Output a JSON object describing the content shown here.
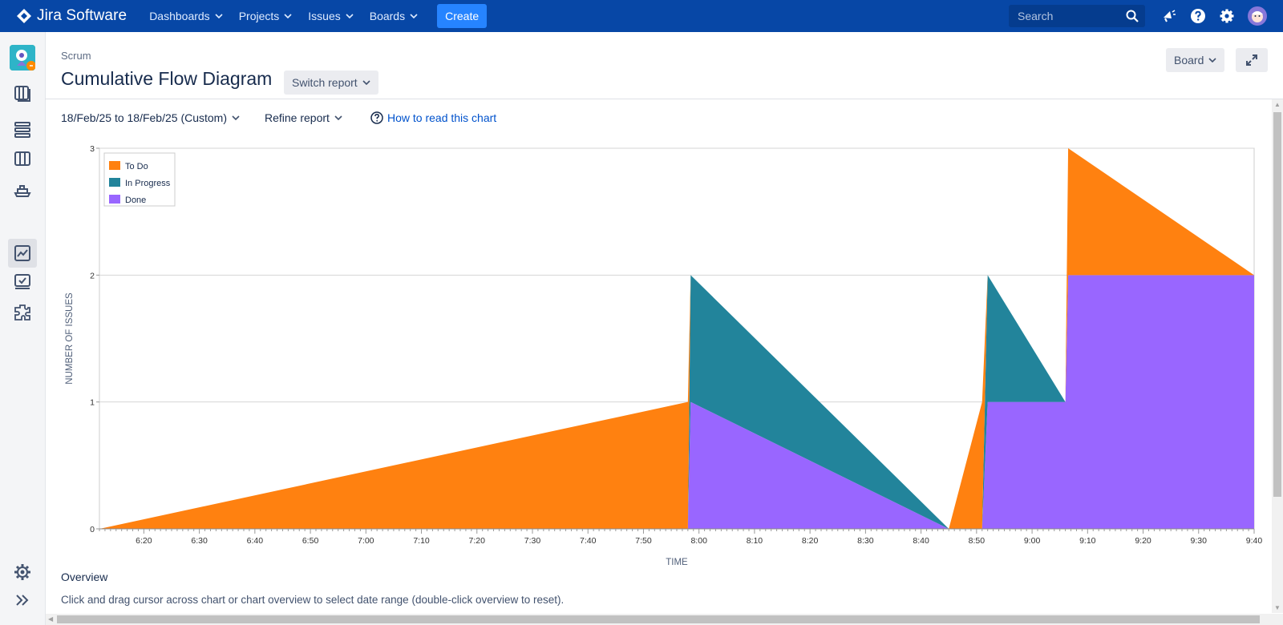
{
  "topnav": {
    "product_name": "Jira Software",
    "menu": [
      {
        "label": "Dashboards"
      },
      {
        "label": "Projects"
      },
      {
        "label": "Issues"
      },
      {
        "label": "Boards"
      }
    ],
    "create_label": "Create",
    "search_placeholder": "Search",
    "icons": [
      "notifications-icon",
      "help-icon",
      "settings-icon",
      "avatar"
    ]
  },
  "sidebar": {
    "icons": [
      "project-avatar",
      "backlog-icon",
      "board-icon",
      "columns-icon",
      "releases-icon",
      "reports-icon",
      "issues-icon",
      "components-icon",
      "settings-icon",
      "expand-icon"
    ],
    "active": "reports-icon"
  },
  "header": {
    "breadcrumb": "Scrum",
    "title": "Cumulative Flow Diagram",
    "switch_report": "Switch report",
    "board_label": "Board"
  },
  "filters": {
    "date_range": "18/Feb/25 to 18/Feb/25 (Custom)",
    "refine_label": "Refine report",
    "howto_label": "How to read this chart"
  },
  "overview": {
    "title": "Overview",
    "hint": "Click and drag cursor across chart or chart overview to select date range (double-click overview to reset)."
  },
  "colors": {
    "nav_bg": "#0747a6",
    "todo": "#ff8110",
    "in_progress": "#22849b",
    "done": "#9966ff",
    "link": "#0052cc"
  },
  "chart_data": {
    "type": "area",
    "stacked": true,
    "xlabel": "TIME",
    "ylabel": "NUMBER OF ISSUES",
    "ylim": [
      0,
      3
    ],
    "yticks": [
      0,
      1,
      2,
      3
    ],
    "xlim": [
      "06:12",
      "09:40"
    ],
    "xticks": [
      "6:20",
      "6:30",
      "6:40",
      "6:50",
      "7:00",
      "7:10",
      "7:20",
      "7:30",
      "7:40",
      "7:50",
      "8:00",
      "8:10",
      "8:20",
      "8:30",
      "8:40",
      "8:50",
      "9:00",
      "9:10",
      "9:20",
      "9:30",
      "9:40"
    ],
    "legend": {
      "position": "top-left",
      "entries": [
        "To Do",
        "In Progress",
        "Done"
      ]
    },
    "grid": "horizontal",
    "series": [
      {
        "name": "Done",
        "points": [
          [
            "06:12",
            0
          ],
          [
            "07:58",
            0
          ],
          [
            "07:58.5",
            1
          ],
          [
            "08:45",
            0
          ],
          [
            "08:51",
            0
          ],
          [
            "08:52",
            1
          ],
          [
            "09:06",
            1
          ],
          [
            "09:06.5",
            2
          ],
          [
            "09:40",
            2
          ]
        ]
      },
      {
        "name": "In Progress",
        "points": [
          [
            "06:12",
            0
          ],
          [
            "07:44.5",
            0
          ],
          [
            "07:58",
            1
          ],
          [
            "07:58.5",
            0
          ],
          [
            "08:45",
            0
          ],
          [
            "08:51",
            1
          ],
          [
            "08:52",
            0
          ],
          [
            "09:06",
            0
          ],
          [
            "09:06.5",
            0
          ],
          [
            "09:40",
            0
          ]
        ]
      },
      {
        "name": "To Do",
        "points": [
          [
            "06:12",
            0
          ],
          [
            "07:44.5",
            1
          ],
          [
            "07:58",
            0
          ],
          [
            "07:58.5",
            0
          ],
          [
            "08:45",
            1
          ],
          [
            "08:51",
            0
          ],
          [
            "08:52",
            0
          ],
          [
            "09:06",
            1
          ],
          [
            "09:06.5",
            0
          ],
          [
            "09:40",
            0
          ]
        ]
      }
    ]
  }
}
